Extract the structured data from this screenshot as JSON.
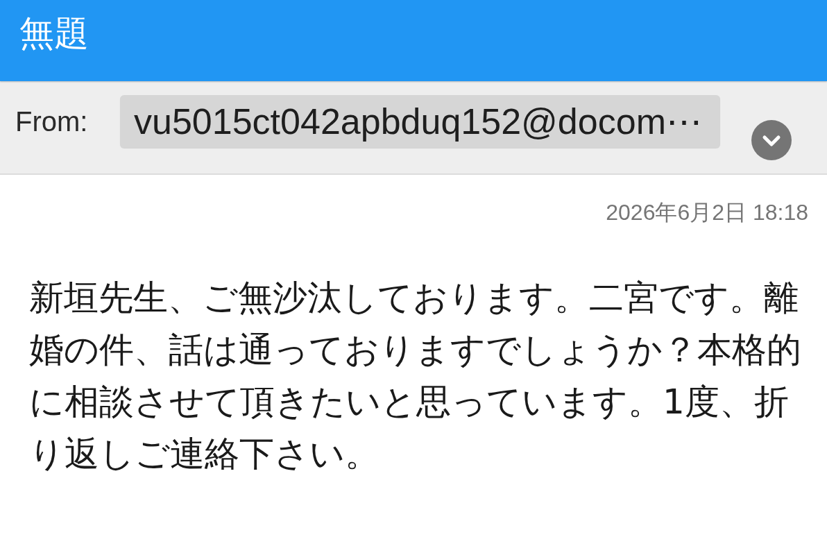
{
  "window": {
    "title": "無題"
  },
  "sender": {
    "label": "From:",
    "address": "vu5015ct042apbduq152@docom⋯"
  },
  "message": {
    "date": "2026年6月2日 18:18",
    "body": "新垣先生、ご無沙汰しております。二宮です。離婚の件、話は通っておりますでしょうか？本格的に相談させて頂きたいと思っています。1度、折り返しご連絡下さい。"
  }
}
